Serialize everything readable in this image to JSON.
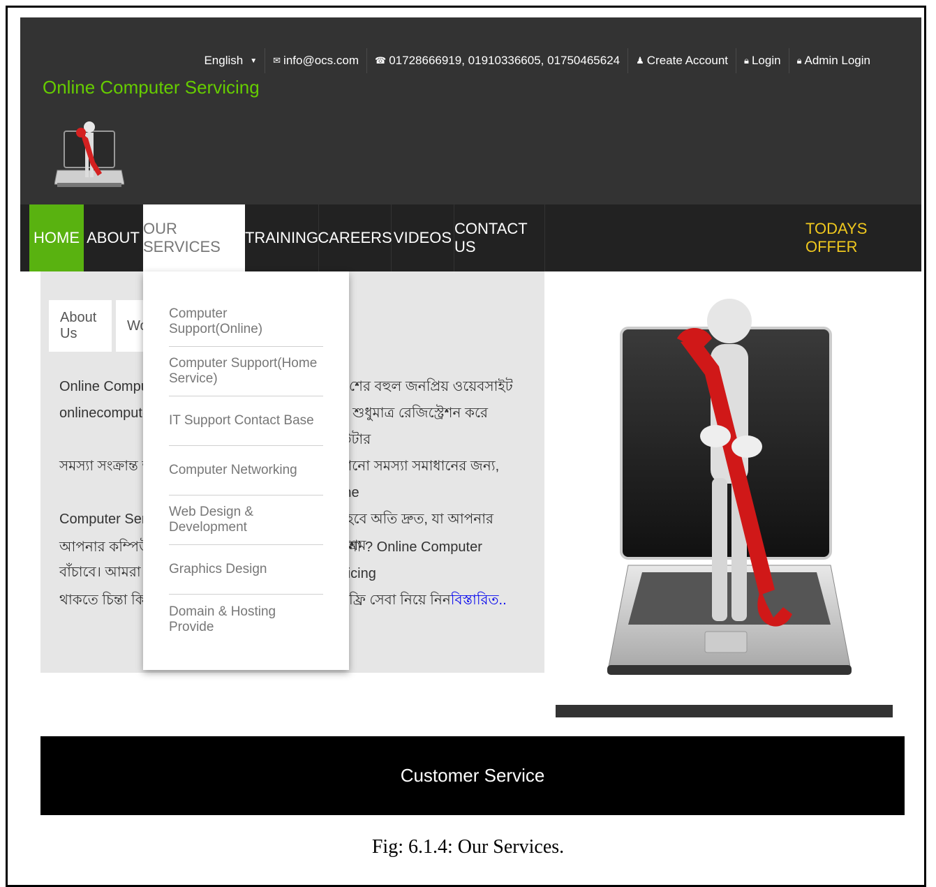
{
  "topbar": {
    "language": "English",
    "email": "info@ocs.com",
    "phones": "01728666919, 01910336605, 01750465624",
    "create_account": "Create Account",
    "login": "Login",
    "admin_login": "Admin Login"
  },
  "brand": {
    "name": "Online Computer Servicing"
  },
  "nav": {
    "home": "HOME",
    "about": "ABOUT",
    "services": "OUR SERVICES",
    "training": "TRAINING",
    "careers": "CAREERS",
    "videos": "VIDEOS",
    "contact": "CONTACT US",
    "offer": "TODAYS OFFER"
  },
  "tabs": {
    "about_us": "About Us",
    "second": "Wo"
  },
  "content": {
    "p1_lines": [
      "Online Computer",
      "onlinecomputerse",
      "সমস্যা সংক্রান্ত অনলাই",
      "Computer Servici",
      "বাঁচাবে। আমরা আছি"
    ],
    "p1_right_lines": [
      "শের বহুল জনপ্রিয় ওয়েবসাইট",
      "আপনি শুধুমাত্র রেজিস্ট্রেশন করে কম্পিউটার",
      "যেকোনো সমস্যা সমাধানের জন্য, Online",
      "াধান হবে অতি দ্রুত, যা আপনার সময় ও শ্রম",
      ""
    ],
    "p2_lines": [
      "আপনার কম্পিউটার (",
      "থাকতে চিন্তা কিসের?"
    ],
    "p2_right_lines": [
      "রছেননা ? Online Computer Servicing",
      "ফ্রি সেবা নিয়ে নিন "
    ],
    "read_more": "বিস্তারিত.."
  },
  "dropdown": {
    "items": [
      "Computer Support(Online)",
      "Computer Support(Home Service)",
      "IT Support Contact Base",
      "Computer Networking",
      "Web Design & Development",
      "Graphics Design",
      "Domain & Hosting Provide"
    ]
  },
  "footer": {
    "label": "Customer Service"
  },
  "caption": "Fig: 6.1.4:  Our Services."
}
